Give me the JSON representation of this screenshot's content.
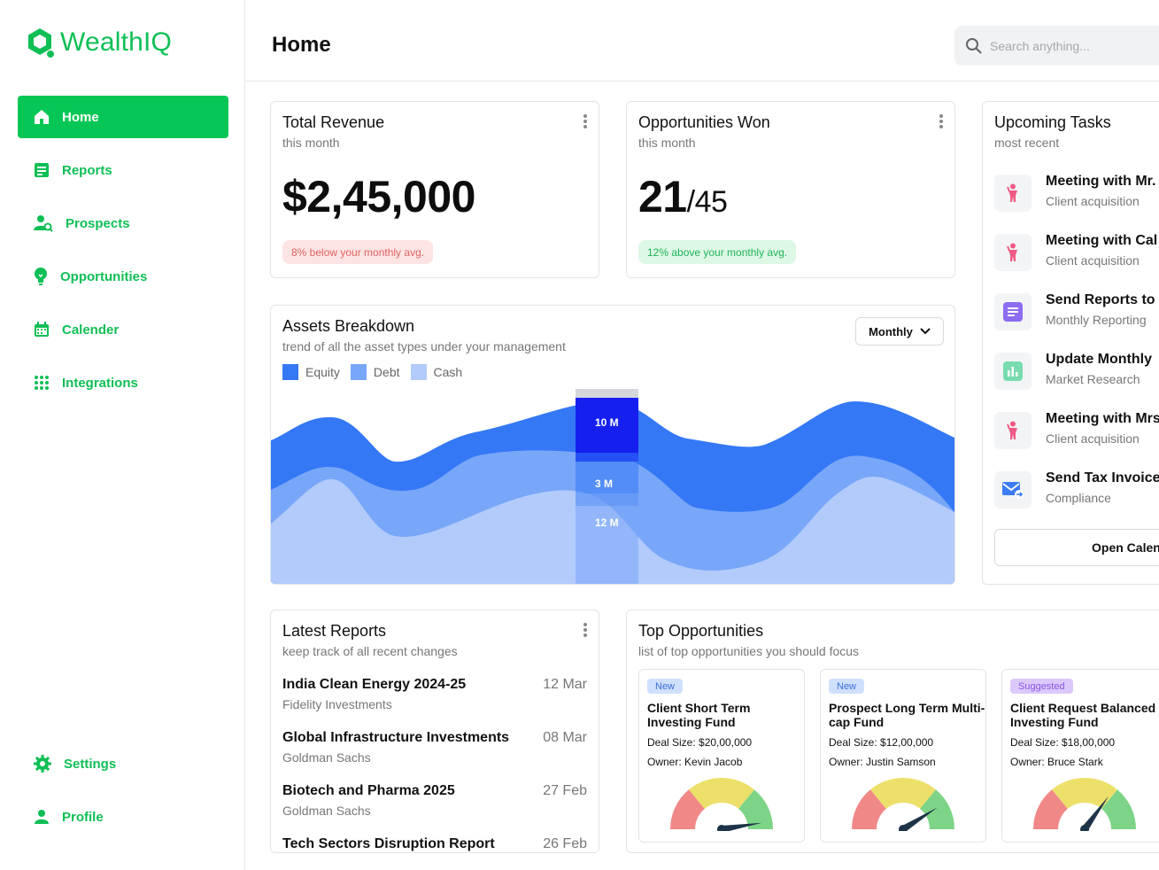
{
  "brand": {
    "name": "WealthIQ",
    "color": "#0fbf55"
  },
  "sidebar": {
    "items": [
      {
        "label": "Home",
        "icon": "home-icon",
        "active": true
      },
      {
        "label": "Reports",
        "icon": "report-icon"
      },
      {
        "label": "Prospects",
        "icon": "prospects-icon"
      },
      {
        "label": "Opportunities",
        "icon": "lightbulb-icon"
      },
      {
        "label": "Calender",
        "icon": "calendar-icon"
      },
      {
        "label": "Integrations",
        "icon": "grid-icon"
      }
    ],
    "bottom": [
      {
        "label": "Settings",
        "icon": "gear-icon"
      },
      {
        "label": "Profile",
        "icon": "user-icon"
      }
    ]
  },
  "header": {
    "title": "Home",
    "search_placeholder": "Search anything..."
  },
  "revenue": {
    "title": "Total Revenue",
    "subtitle": "this month",
    "value": "$2,45,000",
    "note": "8% below your monthly avg."
  },
  "opportunities_won": {
    "title": "Opportunities Won",
    "subtitle": "this month",
    "won": "21",
    "total": "/45",
    "note": "12% above your monthly avg."
  },
  "assets": {
    "title": "Assets Breakdown",
    "subtitle": "trend of all the asset types under your management",
    "period": "Monthly",
    "legend": [
      "Equity",
      "Debt",
      "Cash"
    ],
    "colors": {
      "equity": "#3478f6",
      "debt": "#78a6f8",
      "cash": "#b2cbfb",
      "highlight": "#1520f0"
    },
    "chart_data": {
      "type": "area",
      "series": [
        {
          "name": "Equity",
          "values": [
            10,
            12,
            9,
            10,
            11,
            10,
            8,
            7,
            9,
            10,
            9,
            8
          ]
        },
        {
          "name": "Debt",
          "values": [
            3,
            3,
            4,
            4,
            3,
            3,
            4,
            5,
            6,
            7,
            7,
            6
          ]
        },
        {
          "name": "Cash",
          "values": [
            6,
            8,
            5,
            6,
            10,
            12,
            5,
            3,
            6,
            10,
            8,
            6
          ]
        }
      ],
      "highlight": {
        "index": 4,
        "labels": [
          "10 M",
          "3 M",
          "12 M"
        ]
      }
    }
  },
  "tasks": {
    "title": "Upcoming Tasks",
    "subtitle": "most recent",
    "items": [
      {
        "title": "Meeting with Mr.",
        "sub": "Client acquisition",
        "icon": "person-icon"
      },
      {
        "title": "Meeting with Cal",
        "sub": "Client acquisition",
        "icon": "person-icon"
      },
      {
        "title": "Send Reports to",
        "sub": "Monthly Reporting",
        "icon": "document-icon"
      },
      {
        "title": "Update Monthly",
        "sub": "Market Research",
        "icon": "chart-icon"
      },
      {
        "title": "Meeting with Mrs",
        "sub": "Client acquisition",
        "icon": "person-icon"
      },
      {
        "title": "Send Tax Invoice",
        "sub": "Compliance",
        "icon": "mail-icon"
      }
    ],
    "button": "Open Calen"
  },
  "reports": {
    "title": "Latest Reports",
    "subtitle": "keep track of all recent changes",
    "items": [
      {
        "title": "India Clean Energy 2024-25",
        "sub": "Fidelity Investments",
        "date": "12 Mar"
      },
      {
        "title": "Global Infrastructure Investments",
        "sub": "Goldman Sachs",
        "date": "08 Mar"
      },
      {
        "title": "Biotech and Pharma 2025",
        "sub": "Goldman Sachs",
        "date": "27 Feb"
      },
      {
        "title": "Tech Sectors Disruption Report",
        "sub": "",
        "date": "26 Feb"
      }
    ]
  },
  "top_opps": {
    "title": "Top Opportunities",
    "subtitle": "list of top opportunities you should focus",
    "items": [
      {
        "badge": "New",
        "title": "Client Short Term Investing Fund",
        "deal": "Deal Size: $20,00,000",
        "owner": "Owner: Kevin Jacob",
        "score": 0.95
      },
      {
        "badge": "New",
        "title": "Prospect Long Term Multi-cap Fund",
        "deal": "Deal Size: $12,00,000",
        "owner": "Owner: Justin Samson",
        "score": 0.82
      },
      {
        "badge": "Suggested",
        "title": "Client Request Balanced Investing Fund",
        "deal": "Deal Size: $18,00,000",
        "owner": "Owner: Bruce Stark",
        "score": 0.7
      }
    ]
  }
}
